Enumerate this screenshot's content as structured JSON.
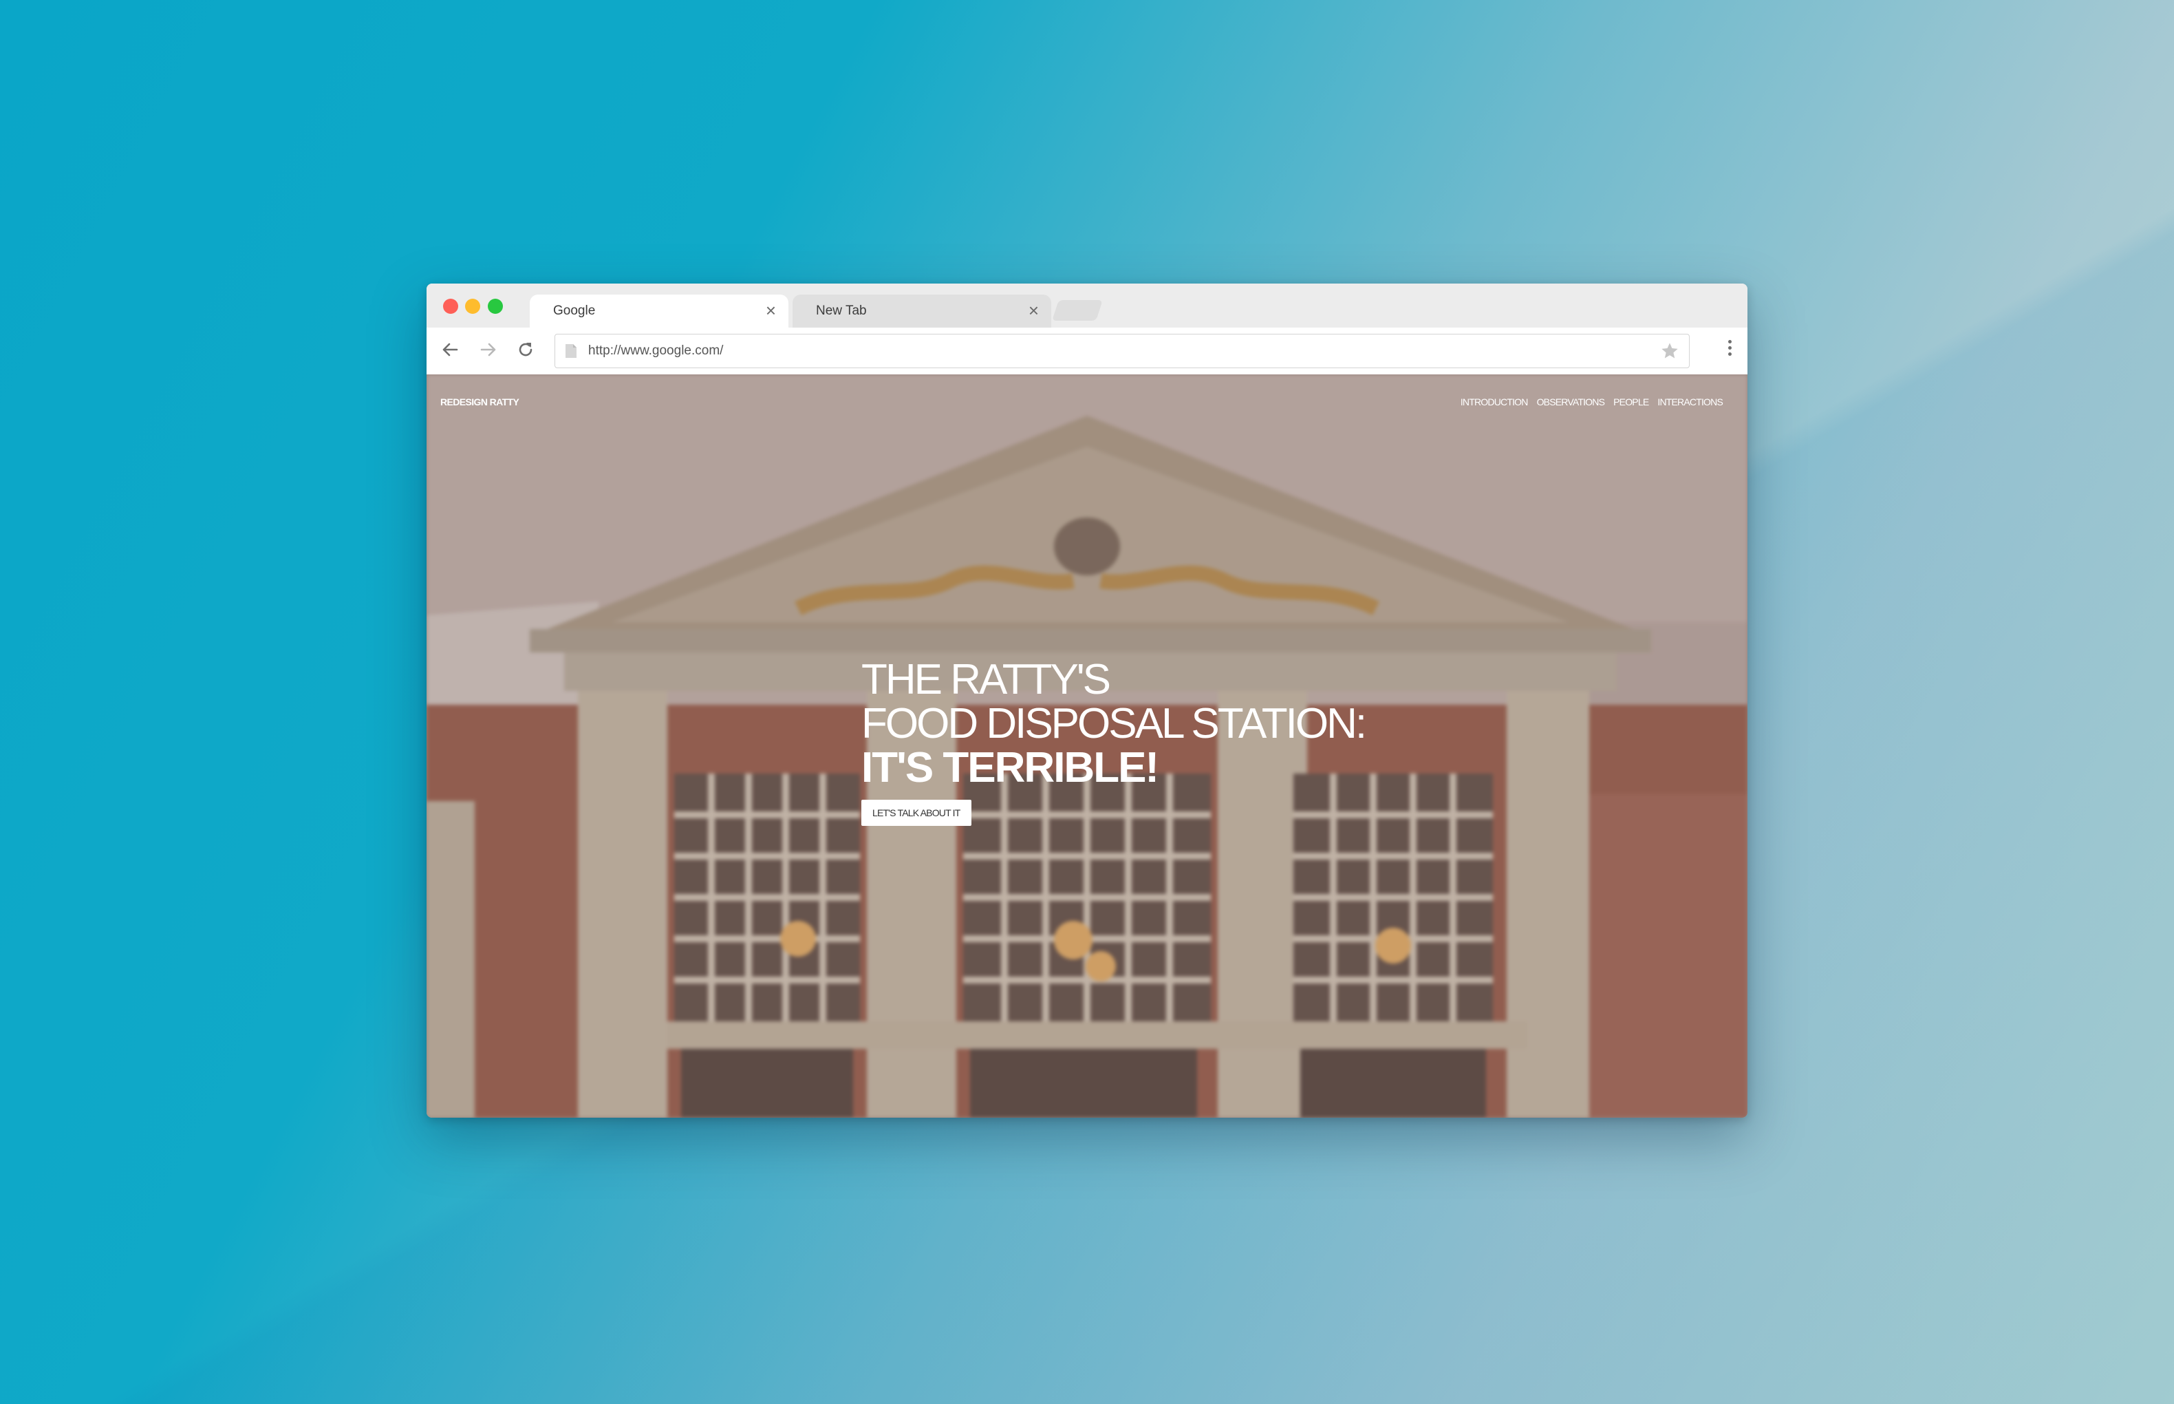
{
  "browser": {
    "tabs": [
      {
        "title": "Google",
        "active": true
      },
      {
        "title": "New Tab",
        "active": false
      }
    ],
    "close_glyph": "×",
    "url": "http://www.google.com/"
  },
  "site": {
    "logo": "REDESIGN RATTY",
    "nav": [
      "INTRODUCTION",
      "OBSERVATIONS",
      "PEOPLE",
      "INTERACTIONS"
    ]
  },
  "hero": {
    "line1": "THE RATTY'S",
    "line2": "FOOD DISPOSAL STATION:",
    "line3": "IT'S TERRIBLE!",
    "cta": "LET'S TALK ABOUT IT"
  },
  "colors": {
    "accent_red": "#fe5f57",
    "accent_yellow": "#febc2e",
    "accent_green": "#28c840",
    "hero_tint": "#9a8680"
  },
  "icons": [
    "back-arrow-icon",
    "forward-arrow-icon",
    "reload-icon",
    "page-icon",
    "star-icon",
    "menu-dots-icon",
    "close-icon"
  ]
}
